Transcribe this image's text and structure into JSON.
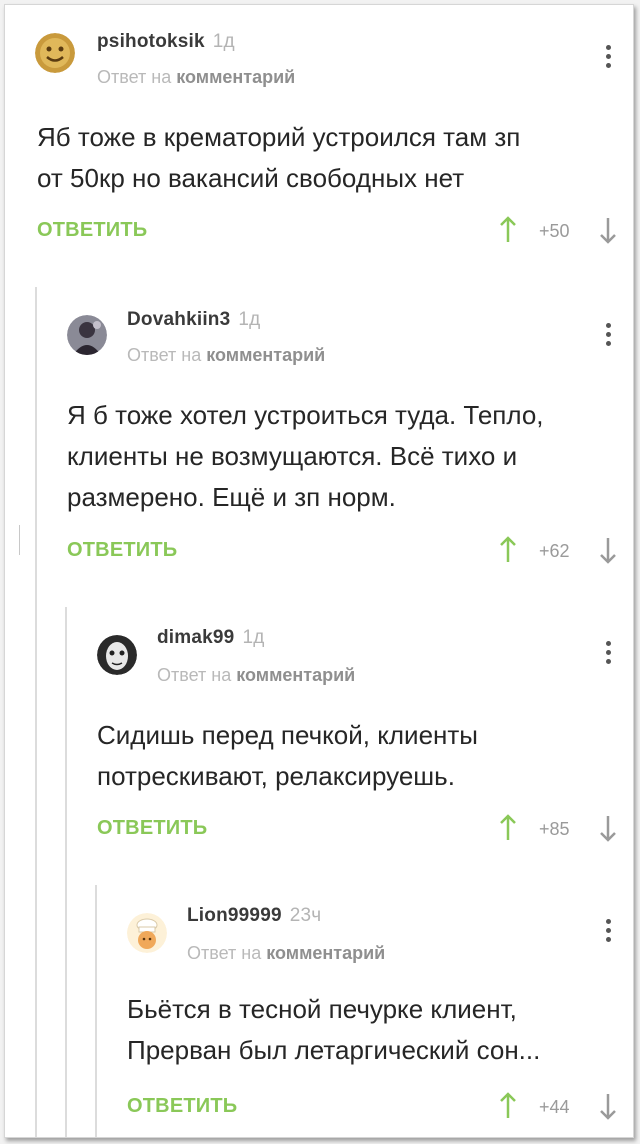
{
  "labels": {
    "reply_prefix": "Ответ на",
    "reply_suffix": "комментарий",
    "reply_button": "ОТВЕТИТЬ"
  },
  "colors": {
    "accent_green": "#8ac858",
    "arrow_up": "#8ac858",
    "arrow_down": "#9a9a9a"
  },
  "comments": [
    {
      "username": "psihotoksik",
      "time": "1д",
      "avatar": "smiley-avatar",
      "text_lines": [
        "Яб тоже в крематорий устроился там зп",
        "от 50кр но вакансий свободных нет"
      ],
      "score": "+50"
    },
    {
      "username": "Dovahkiin3",
      "time": "1д",
      "avatar": "dark-figure-avatar",
      "text_lines": [
        "Я б тоже хотел устроиться туда. Тепло,",
        "клиенты не возмущаются. Всё тихо и",
        "размерено. Ещё и зп норм."
      ],
      "score": "+62"
    },
    {
      "username": "dimak99",
      "time": "1д",
      "avatar": "masked-face-avatar",
      "text_lines": [
        "Сидишь перед печкой, клиенты",
        "потрескивают, релаксируешь."
      ],
      "score": "+85"
    },
    {
      "username": "Lion99999",
      "time": "23ч",
      "avatar": "chef-avatar",
      "text_lines": [
        "Бьётся в тесной печурке клиент,",
        "Прерван был летаргический сон..."
      ],
      "score": "+44"
    }
  ]
}
